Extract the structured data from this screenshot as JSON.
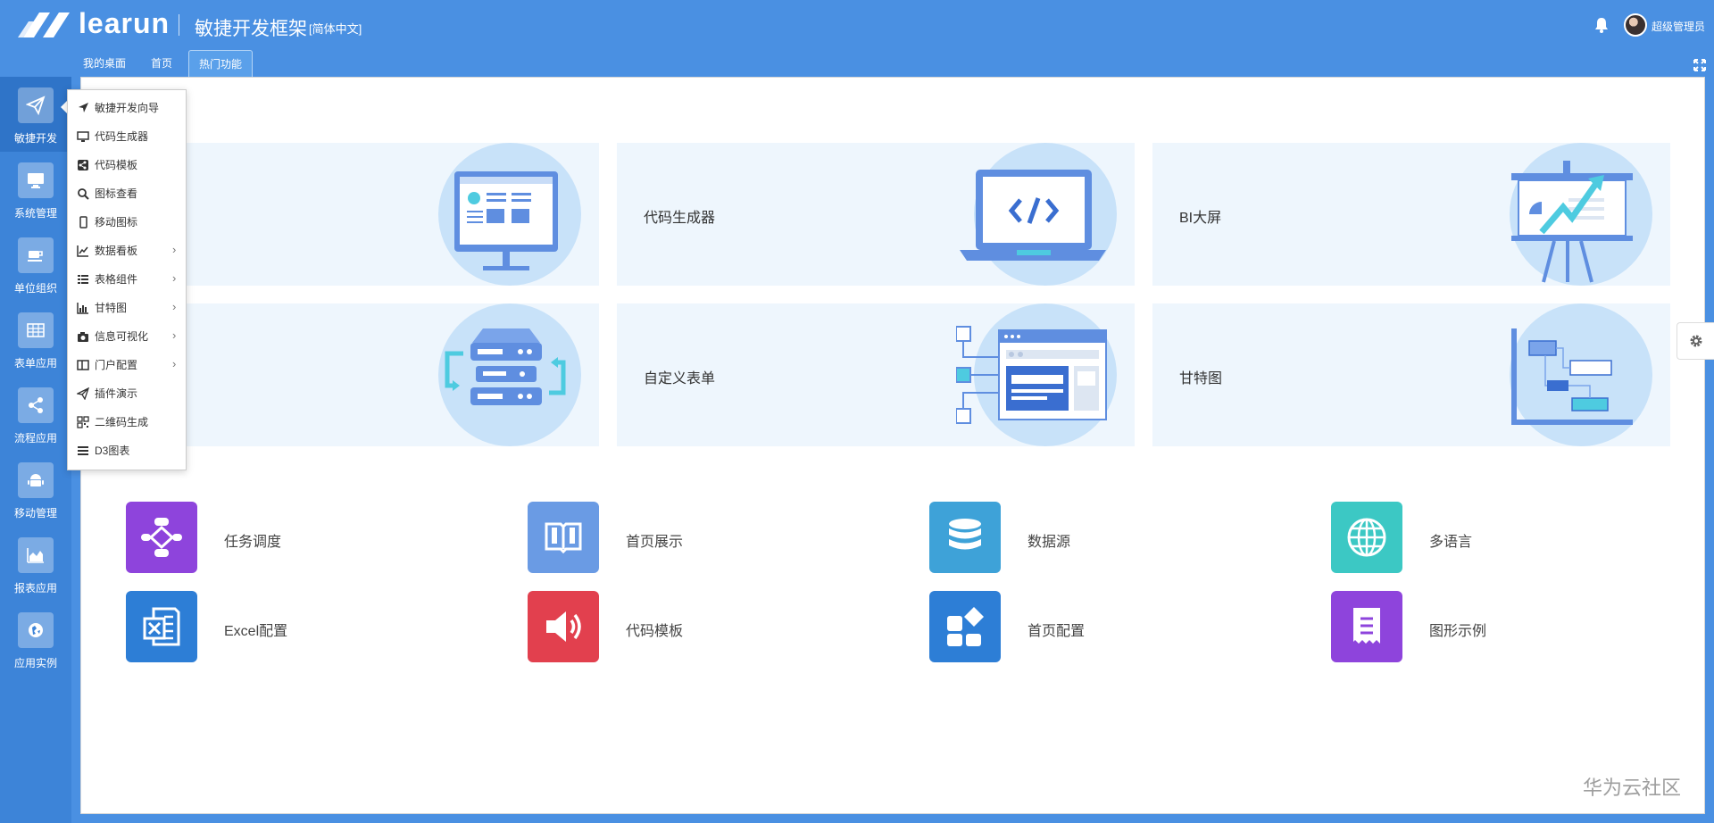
{
  "header": {
    "brand": "learun",
    "title": "敏捷开发框架",
    "language": "[简体中文]",
    "username": "超级管理员"
  },
  "tabs": [
    {
      "label": "我的桌面"
    },
    {
      "label": "首页"
    },
    {
      "label": "热门功能"
    }
  ],
  "sidebar": {
    "items": [
      {
        "label": "敏捷开发",
        "icon": "paper-plane-icon"
      },
      {
        "label": "系统管理",
        "icon": "monitor-icon"
      },
      {
        "label": "单位组织",
        "icon": "coffee-icon"
      },
      {
        "label": "表单应用",
        "icon": "table-icon"
      },
      {
        "label": "流程应用",
        "icon": "share-icon"
      },
      {
        "label": "移动管理",
        "icon": "android-icon"
      },
      {
        "label": "报表应用",
        "icon": "area-chart-icon"
      },
      {
        "label": "应用实例",
        "icon": "globe-icon"
      }
    ]
  },
  "menu": {
    "items": [
      {
        "label": "敏捷开发向导",
        "icon": "location-arrow-icon"
      },
      {
        "label": "代码生成器",
        "icon": "desktop-icon"
      },
      {
        "label": "代码模板",
        "icon": "share-square-icon"
      },
      {
        "label": "图标查看",
        "icon": "search-icon"
      },
      {
        "label": "移动图标",
        "icon": "mobile-icon"
      },
      {
        "label": "数据看板",
        "icon": "line-chart-icon"
      },
      {
        "label": "表格组件",
        "icon": "list-icon"
      },
      {
        "label": "甘特图",
        "icon": "bar-chart-icon"
      },
      {
        "label": "信息可视化",
        "icon": "camera-icon"
      },
      {
        "label": "门户配置",
        "icon": "columns-icon"
      },
      {
        "label": "插件演示",
        "icon": "send-icon"
      },
      {
        "label": "二维码生成",
        "icon": "qrcode-icon"
      },
      {
        "label": "D3图表",
        "icon": "bars-icon"
      }
    ]
  },
  "cards": [
    {
      "label": "",
      "illustration": "monitor-dashboard"
    },
    {
      "label": "代码生成器",
      "illustration": "laptop-code"
    },
    {
      "label": "BI大屏",
      "illustration": "presentation-board"
    },
    {
      "label": "",
      "illustration": "server-sync"
    },
    {
      "label": "自定义表单",
      "illustration": "form-layout"
    },
    {
      "label": "甘特图",
      "illustration": "gantt-chart"
    }
  ],
  "apps": [
    {
      "label": "任务调度",
      "color": "#8e44dc",
      "icon": "workflow-icon"
    },
    {
      "label": "首页展示",
      "color": "#6a9be4",
      "icon": "book-icon"
    },
    {
      "label": "数据源",
      "color": "#3ea2d8",
      "icon": "database-icon"
    },
    {
      "label": "多语言",
      "color": "#3cc8c4",
      "icon": "globe-icon"
    },
    {
      "label": "Excel配置",
      "color": "#2d7ed6",
      "icon": "excel-icon"
    },
    {
      "label": "代码模板",
      "color": "#e2404e",
      "icon": "speaker-icon"
    },
    {
      "label": "首页配置",
      "color": "#2d7ed6",
      "icon": "widgets-icon"
    },
    {
      "label": "图形示例",
      "color": "#8e44dc",
      "icon": "receipt-icon"
    }
  ],
  "watermark": "华为云社区"
}
